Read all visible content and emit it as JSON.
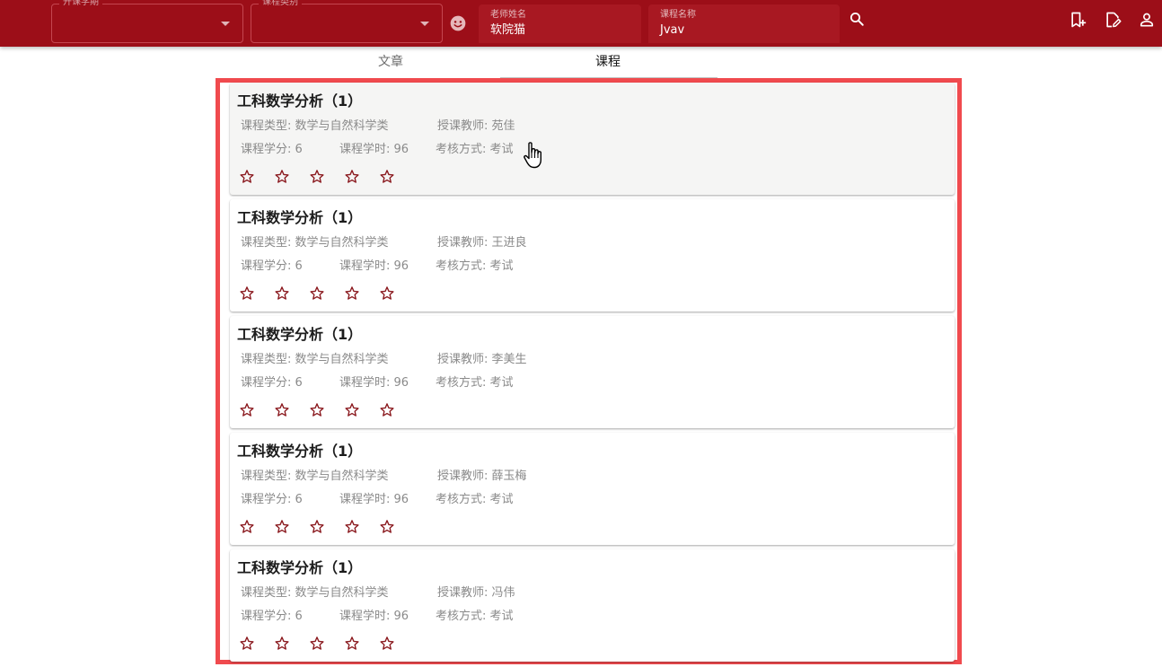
{
  "header": {
    "semester_select": {
      "label": "开课学期",
      "value": ""
    },
    "category_select": {
      "label": "课程类别",
      "value": ""
    },
    "teacher_field": {
      "label": "老师姓名",
      "value": "软院猫"
    },
    "course_field": {
      "label": "课程名称",
      "value": "Jvav"
    },
    "icons": [
      "smiley-icon",
      "search-icon",
      "bookmark-add-icon",
      "edit-note-icon",
      "account-icon"
    ]
  },
  "tabs": [
    {
      "label": "文章",
      "active": false
    },
    {
      "label": "课程",
      "active": true
    }
  ],
  "courses": [
    {
      "name": "工科数学分析（1）",
      "type": "课程类型: 数学与自然科学类",
      "teacher": "授课教师: 苑佳",
      "credit": "课程学分: 6",
      "hours": "课程学时: 96",
      "exam": "考核方式: 考试",
      "rating": 0
    },
    {
      "name": "工科数学分析（1）",
      "type": "课程类型: 数学与自然科学类",
      "teacher": "授课教师: 王进良",
      "credit": "课程学分: 6",
      "hours": "课程学时: 96",
      "exam": "考核方式: 考试",
      "rating": 0
    },
    {
      "name": "工科数学分析（1）",
      "type": "课程类型: 数学与自然科学类",
      "teacher": "授课教师: 李美生",
      "credit": "课程学分: 6",
      "hours": "课程学时: 96",
      "exam": "考核方式: 考试",
      "rating": 0
    },
    {
      "name": "工科数学分析（1）",
      "type": "课程类型: 数学与自然科学类",
      "teacher": "授课教师: 薛玉梅",
      "credit": "课程学分: 6",
      "hours": "课程学时: 96",
      "exam": "考核方式: 考试",
      "rating": 0
    },
    {
      "name": "工科数学分析（1）",
      "type": "课程类型: 数学与自然科学类",
      "teacher": "授课教师: 冯伟",
      "credit": "课程学分: 6",
      "hours": "课程学时: 96",
      "exam": "考核方式: 考试",
      "rating": 0
    }
  ],
  "colors": {
    "primary": "#9c0e18",
    "star": "#8b1a1f",
    "highlight_frame": "#f04a4e"
  }
}
